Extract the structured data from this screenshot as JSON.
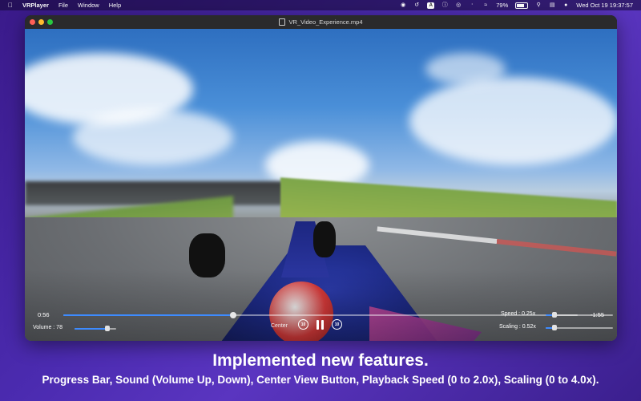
{
  "menubar": {
    "app_name": "VRPlayer",
    "menus": [
      "File",
      "Window",
      "Help"
    ],
    "battery_percent": "79%",
    "datetime": "Wed Oct 19  19:37:57",
    "status_icons": [
      "record-icon",
      "history-icon",
      "text-a-icon",
      "info-icon",
      "airplay-icon",
      "bluetooth-icon",
      "wifi-icon",
      "battery-icon",
      "search-icon",
      "control-center-icon",
      "siri-icon"
    ]
  },
  "window": {
    "title": "VR_Video_Experience.mp4"
  },
  "player": {
    "elapsed": "0:56",
    "remaining": "-1:55",
    "progress_fraction": 0.33,
    "volume_label": "Volume : 78",
    "volume_fraction": 0.78,
    "center_label": "Center",
    "skip_back_label": "10",
    "skip_forward_label": "10",
    "speed_label": "Speed : 0.25x",
    "speed_fraction": 0.125,
    "scaling_label": "Scaling : 0.52x",
    "scaling_fraction": 0.13
  },
  "caption": {
    "title": "Implemented new features.",
    "subtitle": "Progress Bar, Sound (Volume Up, Down), Center View Button, Playback Speed (0 to 2.0x), Scaling (0 to 4.0x)."
  },
  "colors": {
    "accent": "#3d8bff",
    "background": "#4b2bb0"
  }
}
